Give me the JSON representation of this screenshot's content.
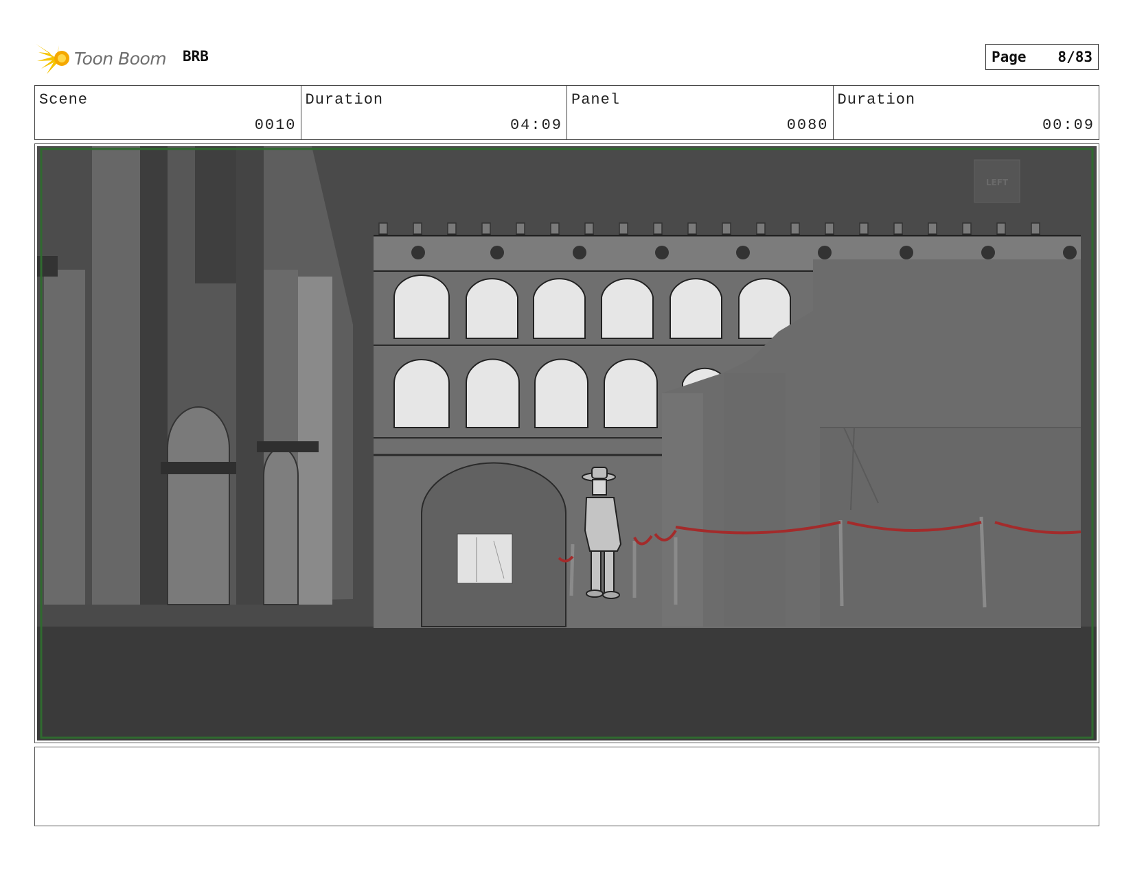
{
  "header": {
    "logo_text": "Toon Boom",
    "project": "BRB",
    "page_label": "Page",
    "page_value": "8/83"
  },
  "info": {
    "scene_label": "Scene",
    "scene_value": "0010",
    "scene_duration_label": "Duration",
    "scene_duration_value": "04:09",
    "panel_label": "Panel",
    "panel_value": "0080",
    "panel_duration_label": "Duration",
    "panel_duration_value": "00:09"
  },
  "panel": {
    "sign_text": "LEFT"
  },
  "colors": {
    "frame_border": "#2f6a2f",
    "rope": "#a32b2b",
    "logo_star": "#f5c400"
  }
}
